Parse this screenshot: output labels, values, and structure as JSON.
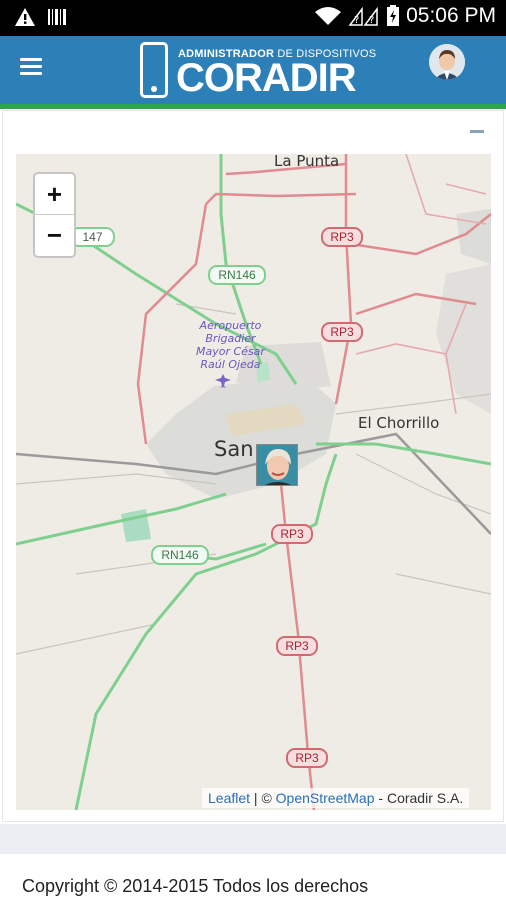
{
  "status_bar": {
    "time": "05:06 PM",
    "icons": [
      "warning-icon",
      "barcode-icon",
      "wifi-icon",
      "signal-icon",
      "battery-icon"
    ]
  },
  "header": {
    "logo_small_bold": "ADMINISTRADOR",
    "logo_small_thin": "DE DISPOSITIVOS",
    "logo_big": "CORADIR",
    "bg_color": "#2d7fb8",
    "accent_color": "#2ea44f"
  },
  "map": {
    "zoom_in": "+",
    "zoom_out": "−",
    "places": {
      "la_punta": "La Punta",
      "el_chorrillo": "El Chorrillo",
      "san_luis": "San",
      "airport": [
        "Aeropuerto",
        "Brigadier",
        "Mayor César",
        "Raúl Ojeda"
      ]
    },
    "road_labels": {
      "rp147": "147",
      "rp3_a": "RP3",
      "rp3_b": "RP3",
      "rp3_c": "RP3",
      "rp3_d": "RP3",
      "rp3_e": "RP3",
      "rn146_a": "RN146",
      "rn146_b": "RN146"
    },
    "attribution": {
      "leaflet": "Leaflet",
      "sep": " | © ",
      "osm": "OpenStreetMap",
      "suffix": " - Coradir S.A."
    }
  },
  "footer": {
    "copyright": "Copyright © 2014-2015 Todos los derechos"
  }
}
